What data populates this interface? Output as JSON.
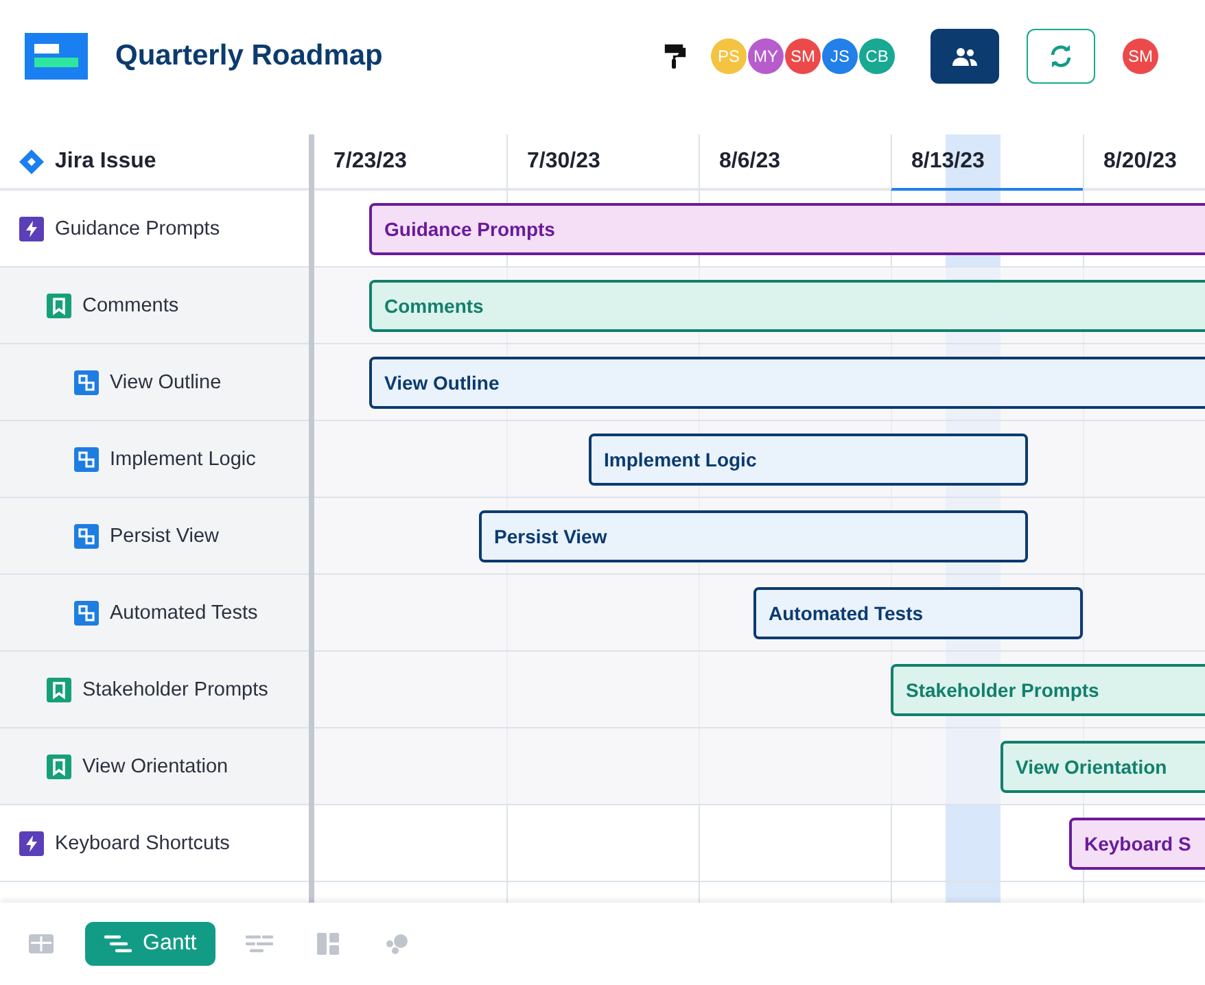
{
  "header": {
    "title": "Quarterly Roadmap",
    "collaborators": [
      {
        "initials": "PS",
        "color": "#f5c342"
      },
      {
        "initials": "MY",
        "color": "#b75ccd"
      },
      {
        "initials": "SM",
        "color": "#ec4a4a"
      },
      {
        "initials": "JS",
        "color": "#2280e8"
      },
      {
        "initials": "CB",
        "color": "#19a892"
      }
    ],
    "user": {
      "initials": "SM",
      "color": "#ec4a4a"
    }
  },
  "table": {
    "column_header": "Jira Issue",
    "dates": [
      {
        "label": "7/23/23",
        "selected": false
      },
      {
        "label": "7/30/23",
        "selected": false
      },
      {
        "label": "8/6/23",
        "selected": false
      },
      {
        "label": "8/13/23",
        "selected": true
      },
      {
        "label": "8/20/23",
        "selected": false
      }
    ],
    "rows": [
      {
        "kind": "epic",
        "label": "Guidance Prompts",
        "bar": "Guidance Prompts",
        "children": [
          {
            "kind": "story",
            "label": "Comments",
            "bar": "Comments",
            "children": [
              {
                "kind": "subtask",
                "label": "View Outline",
                "bar": "View Outline"
              },
              {
                "kind": "subtask",
                "label": "Implement Logic",
                "bar": "Implement Logic"
              },
              {
                "kind": "subtask",
                "label": "Persist View",
                "bar": "Persist View"
              },
              {
                "kind": "subtask",
                "label": "Automated Tests",
                "bar": "Automated Tests"
              }
            ]
          },
          {
            "kind": "story",
            "label": "Stakeholder Prompts",
            "bar": "Stakeholder Prompts"
          },
          {
            "kind": "story",
            "label": "View Orientation",
            "bar": "View Orientation"
          }
        ]
      },
      {
        "kind": "epic",
        "label": "Keyboard Shortcuts",
        "bar": "Keyboard S"
      }
    ]
  },
  "footer": {
    "views": [
      {
        "kind": "table",
        "selected": false
      },
      {
        "kind": "gantt",
        "label": "Gantt",
        "selected": true
      },
      {
        "kind": "timeline",
        "selected": false
      },
      {
        "kind": "board",
        "selected": false
      },
      {
        "kind": "chart",
        "selected": false
      }
    ]
  }
}
